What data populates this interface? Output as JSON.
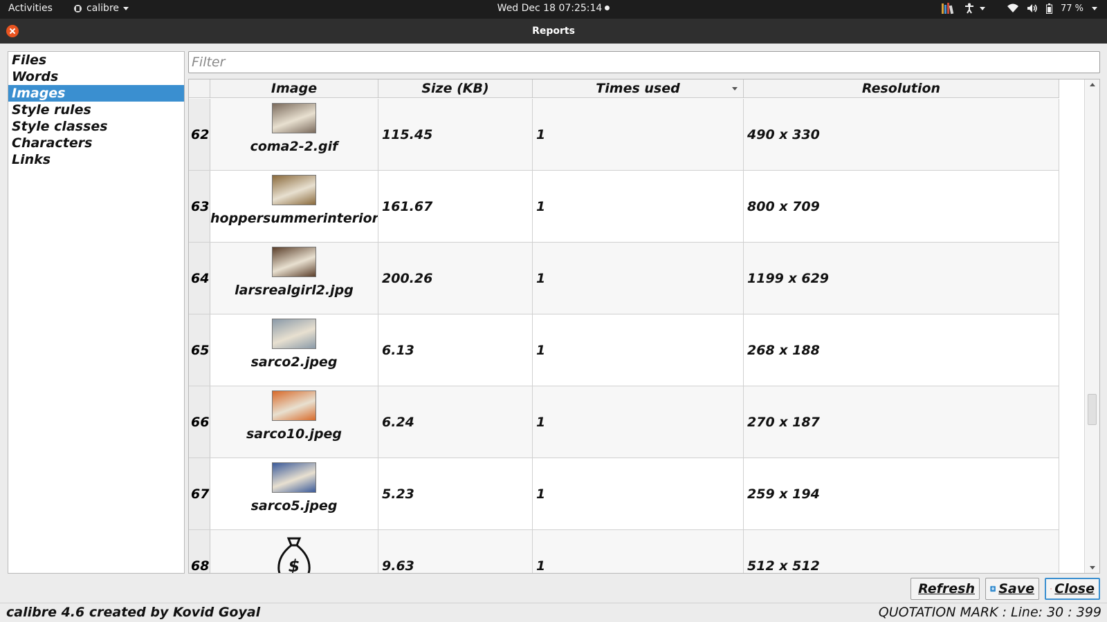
{
  "topbar": {
    "activities": "Activities",
    "app_name": "calibre",
    "clock": "Wed Dec 18  07:25:14",
    "battery": "77 %"
  },
  "window": {
    "title": "Reports"
  },
  "sidebar": {
    "items": [
      {
        "label": "Files",
        "selected": false
      },
      {
        "label": "Words",
        "selected": false
      },
      {
        "label": "Images",
        "selected": true
      },
      {
        "label": "Style rules",
        "selected": false
      },
      {
        "label": "Style classes",
        "selected": false
      },
      {
        "label": "Characters",
        "selected": false
      },
      {
        "label": "Links",
        "selected": false
      }
    ]
  },
  "filter": {
    "placeholder": "Filter",
    "value": ""
  },
  "table": {
    "columns": [
      "Image",
      "Size (KB)",
      "Times used",
      "Resolution"
    ],
    "sorted_column": "Times used",
    "rows": [
      {
        "num": "62",
        "file": "coma2-2.gif",
        "size": "115.45",
        "used": "1",
        "res": "490 x 330",
        "thumb": "#7a6a5c"
      },
      {
        "num": "63",
        "file": "hoppersummerinteriorpainting.jpg",
        "size": "161.67",
        "used": "1",
        "res": "800 x 709",
        "thumb": "#8a6a3c"
      },
      {
        "num": "64",
        "file": "larsrealgirl2.jpg",
        "size": "200.26",
        "used": "1",
        "res": "1199 x 629",
        "thumb": "#5a3e2a"
      },
      {
        "num": "65",
        "file": "sarco2.jpeg",
        "size": "6.13",
        "used": "1",
        "res": "268 x 188",
        "thumb": "#8a9aa8"
      },
      {
        "num": "66",
        "file": "sarco10.jpeg",
        "size": "6.24",
        "used": "1",
        "res": "270 x 187",
        "thumb": "#d86a2a"
      },
      {
        "num": "67",
        "file": "sarco5.jpeg",
        "size": "5.23",
        "used": "1",
        "res": "259 x 194",
        "thumb": "#3a5a9a"
      },
      {
        "num": "68",
        "file": "",
        "size": "9.63",
        "used": "1",
        "res": "512 x 512",
        "thumb": "money-bag-icon"
      }
    ]
  },
  "buttons": {
    "refresh": "Refresh",
    "save": "Save",
    "close": "Close"
  },
  "status": {
    "left": "calibre 4.6 created by Kovid Goyal",
    "right": "QUOTATION MARK : Line: 30 : 399"
  }
}
